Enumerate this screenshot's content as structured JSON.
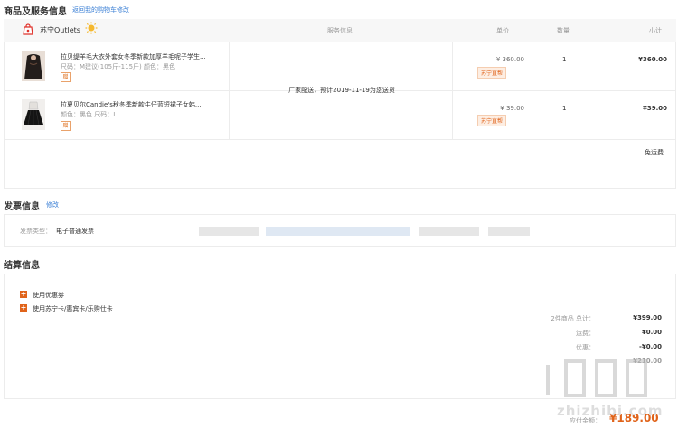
{
  "goods_section": {
    "title": "商品及服务信息",
    "back_link": "返回我的购物车修改",
    "columns": {
      "service": "服务信息",
      "unit_price": "单价",
      "quantity": "数量",
      "subtotal": "小计"
    },
    "store_name": "苏宁Outlets",
    "delivery_note": "厂家配送，预计2019-11-19为您送货",
    "items": [
      {
        "name": "拉贝缇羊毛大衣外套女冬季新款加厚羊毛呢子学生...",
        "attrs": "尺码：M建议(105斤-115斤)   颜色：黑色",
        "gift": "赠",
        "price": "¥ 360.00",
        "badge": "苏宁直帮",
        "qty": "1",
        "subtotal": "¥360.00"
      },
      {
        "name": "拉夏贝尔Candie's秋冬季新款牛仔蓝短裙子女韩...",
        "attrs": "颜色：黑色   尺码：L",
        "gift": "赠",
        "price": "¥ 39.00",
        "badge": "苏宁直帮",
        "qty": "1",
        "subtotal": "¥39.00"
      }
    ],
    "shipping_free": "免运费"
  },
  "invoice_section": {
    "title": "发票信息",
    "edit_link": "修改",
    "type_label": "发票类型：",
    "type_value": "电子普通发票"
  },
  "settlement_section": {
    "title": "结算信息",
    "options": [
      "使用优惠券",
      "使用苏宁卡/惠宾卡/乐购仕卡"
    ],
    "summary": [
      {
        "label": "2件商品 总计：",
        "value": "¥399.00"
      },
      {
        "label": "运费：",
        "value": "¥0.00"
      },
      {
        "label": "优惠：",
        "value": "-¥0.00"
      },
      {
        "label": "",
        "value": "¥210.00"
      }
    ],
    "payable_label": "应付金额：",
    "payable_value": "¥189.00"
  },
  "watermark": {
    "text": "值 什么值得买",
    "url": "zhizhibi.com"
  },
  "colors": {
    "accent": "#e0631a",
    "link": "#3a7fd5",
    "border": "#ececec"
  }
}
